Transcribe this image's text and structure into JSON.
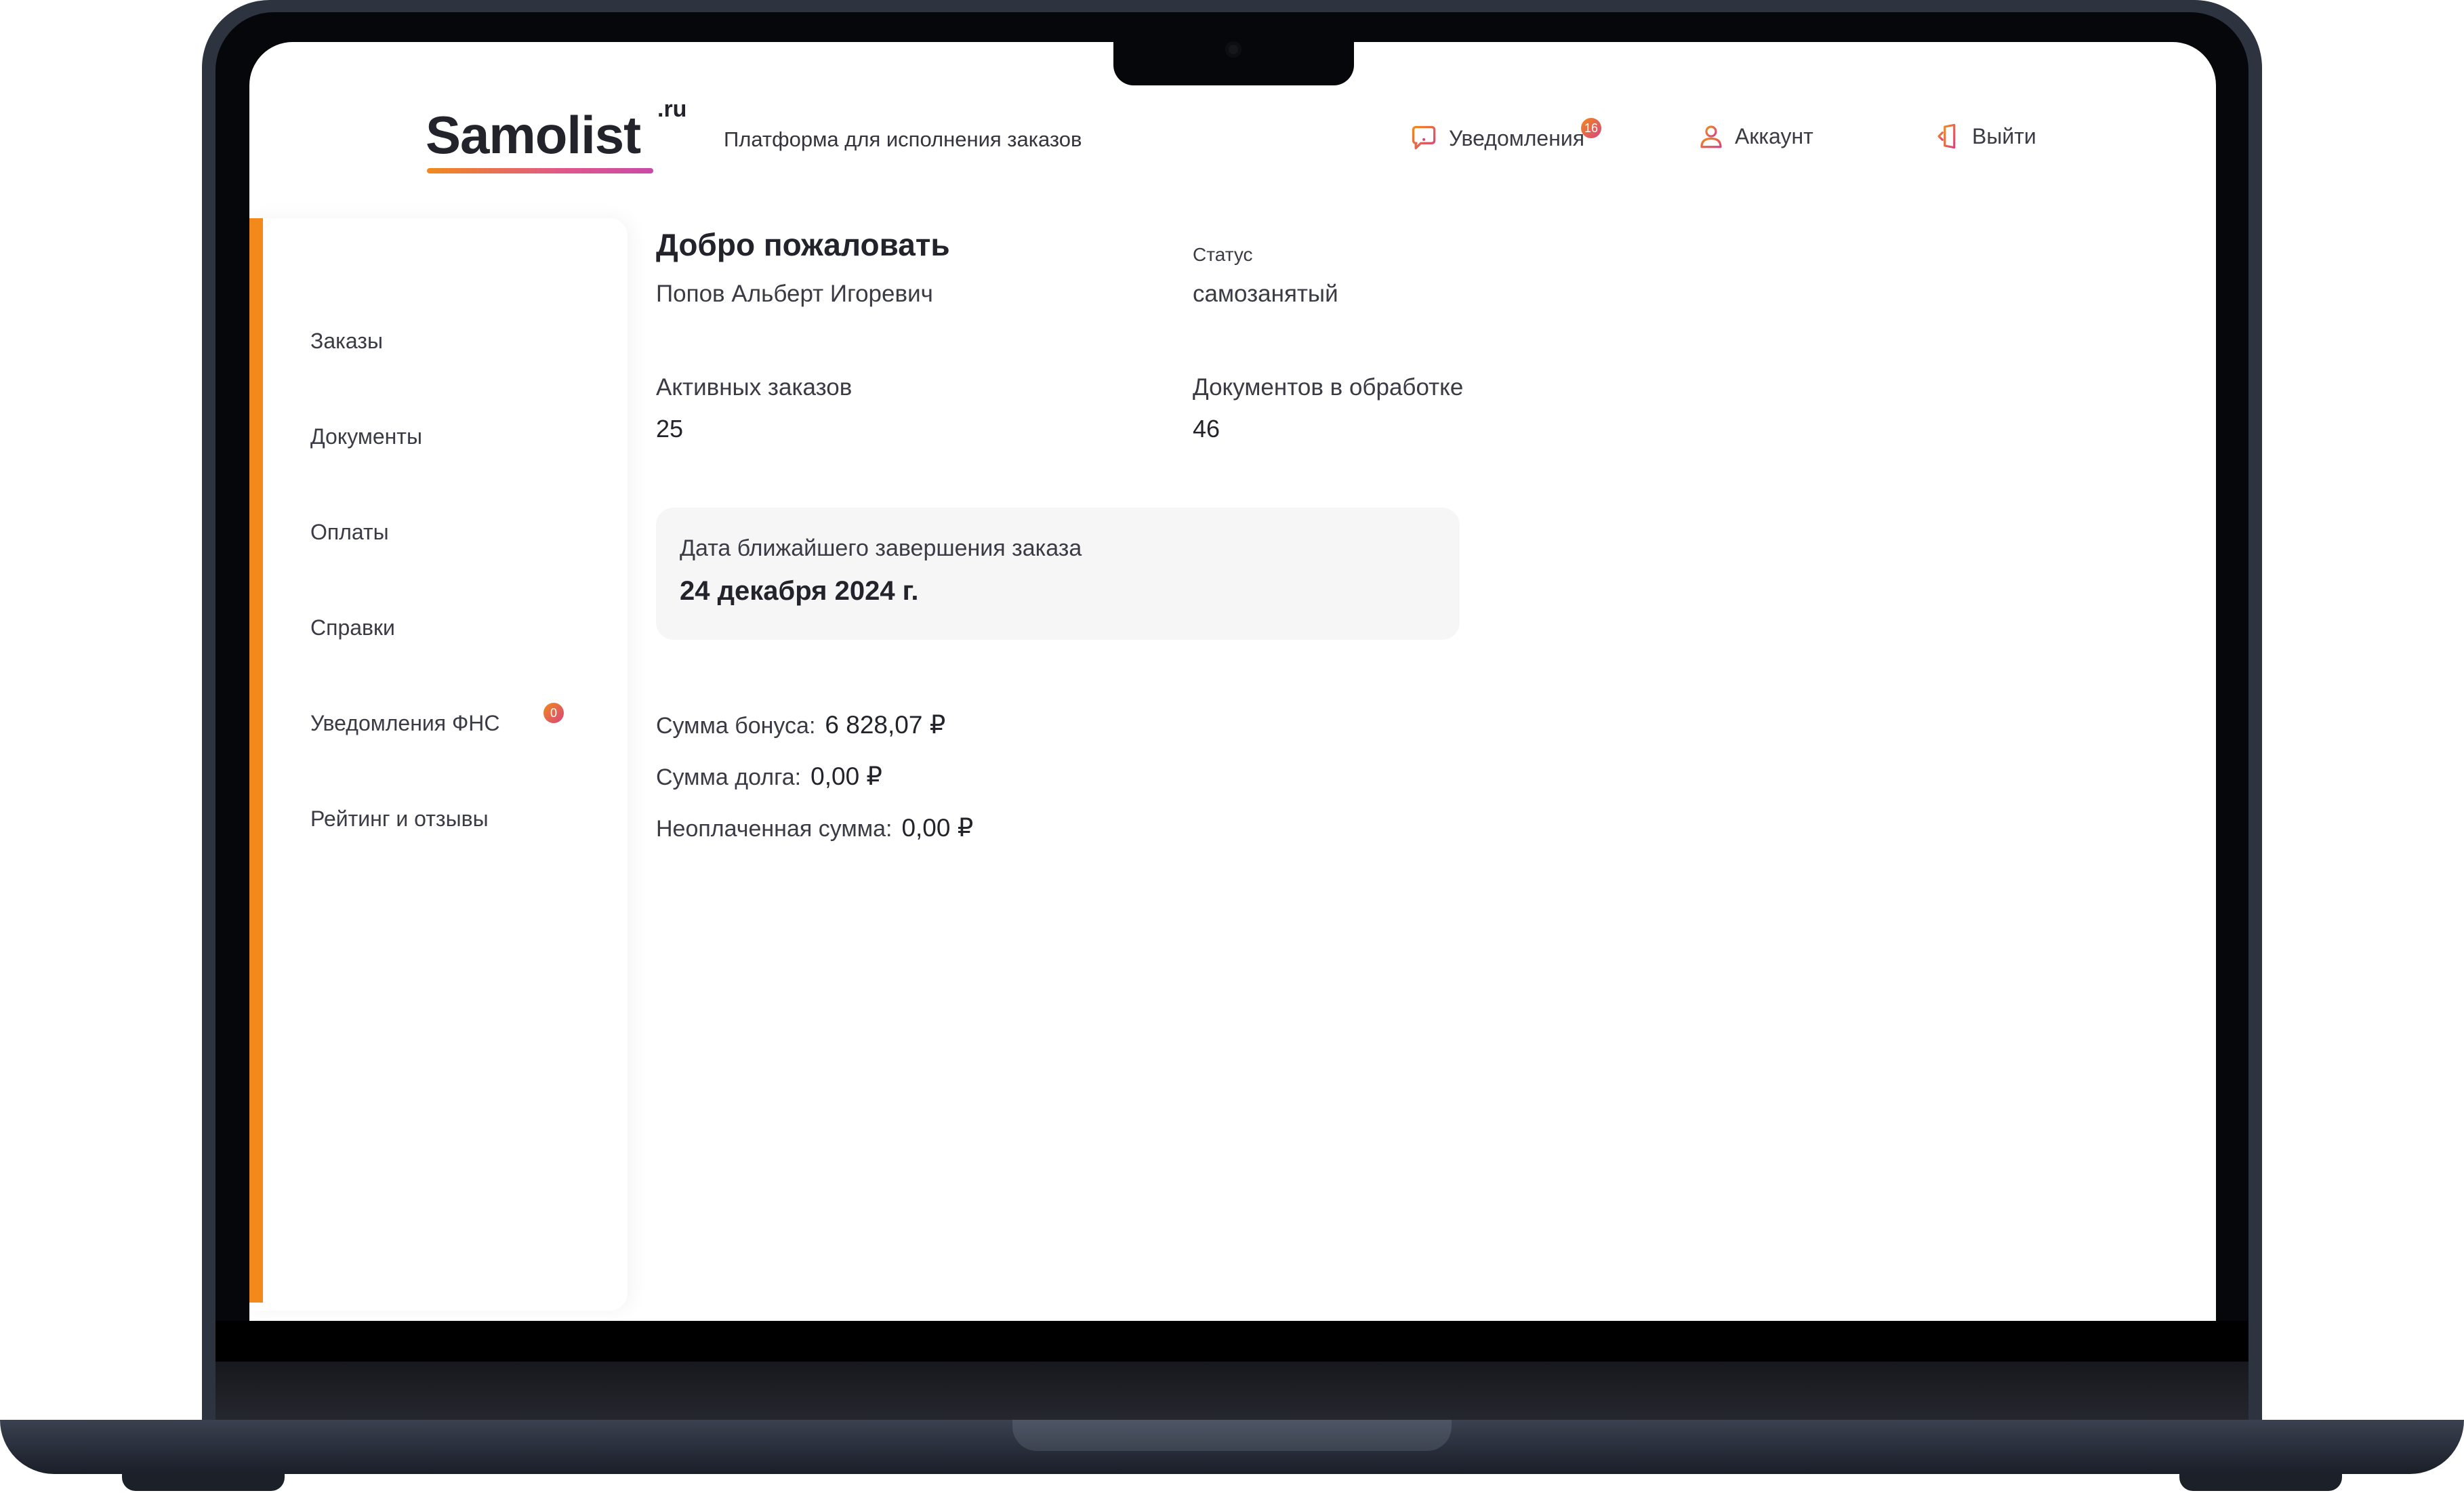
{
  "header": {
    "logo_text": "Samolist",
    "logo_tld": ".ru",
    "tagline": "Платформа для исполнения заказов",
    "notifications_label": "Уведомления",
    "notifications_count": "16",
    "account_label": "Аккаунт",
    "logout_label": "Выйти"
  },
  "sidebar": {
    "items": [
      {
        "label": "Заказы"
      },
      {
        "label": "Документы"
      },
      {
        "label": "Оплаты"
      },
      {
        "label": "Справки"
      },
      {
        "label": "Уведомления ФНС",
        "badge": "0"
      },
      {
        "label": "Рейтинг и отзывы"
      }
    ]
  },
  "main": {
    "welcome_title": "Добро пожаловать",
    "user_name": "Попов Альберт Игоревич",
    "status_label": "Статус",
    "status_value": "самозанятый",
    "active_orders_label": "Активных заказов",
    "active_orders_value": "25",
    "docs_label": "Документов в обработке",
    "docs_value": "46",
    "nearest_label": "Дата ближайшего завершения заказа",
    "nearest_value": "24 декабря 2024 г.",
    "bonus_label": "Сумма бонуса:",
    "bonus_value": "6 828,07 ₽",
    "debt_label": "Сумма долга:",
    "debt_value": "0,00 ₽",
    "unpaid_label": "Неоплаченная сумма:",
    "unpaid_value": "0,00 ₽"
  },
  "colors": {
    "accent": "#f2891a",
    "badge_gradient_end": "#d9437e",
    "card_bg": "#f6f6f6",
    "laptop_frame": "#2e3340"
  },
  "icons": {
    "notifications": "chat-alert-icon",
    "account": "user-icon",
    "logout": "logout-door-icon"
  }
}
